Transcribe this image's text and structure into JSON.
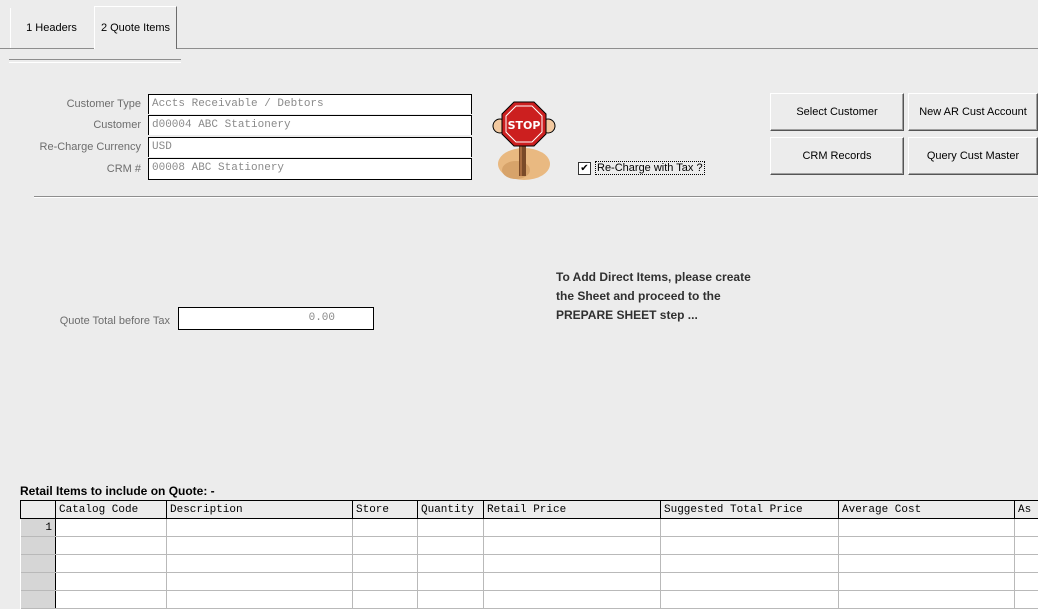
{
  "tabs": [
    {
      "label": "1 Headers"
    },
    {
      "label": "2 Quote Items"
    }
  ],
  "customer": {
    "type_label": "Customer Type",
    "type_value": "Accts Receivable / Debtors",
    "customer_label": "Customer",
    "customer_value": "d00004 ABC Stationery",
    "currency_label": "Re-Charge Currency",
    "currency_value": "USD",
    "crm_label": "CRM #",
    "crm_value": "00008 ABC Stationery"
  },
  "recharge_tax": {
    "label": "Re-Charge with Tax ?",
    "checked": true
  },
  "buttons": {
    "select_customer": "Select Customer",
    "new_ar_account": "New AR Cust Account",
    "crm_records": "CRM Records",
    "query_cust_master": "Query Cust Master"
  },
  "quote_total": {
    "label": "Quote Total before Tax",
    "value": "0.00"
  },
  "notice": {
    "line1": "To Add Direct Items, please create",
    "line2": "the Sheet and proceed to the",
    "line3": "PREPARE SHEET step ..."
  },
  "retail_items": {
    "title": "Retail Items to include on Quote: -",
    "columns": [
      "Catalog Code",
      "Description",
      "Store",
      "Quantity",
      "Retail Price",
      "Suggested Total Price",
      "Average Cost",
      "As"
    ],
    "row_numbers": [
      "1",
      "",
      "",
      "",
      ""
    ]
  },
  "icons": {
    "stop_sign": "stop-sign-icon"
  }
}
